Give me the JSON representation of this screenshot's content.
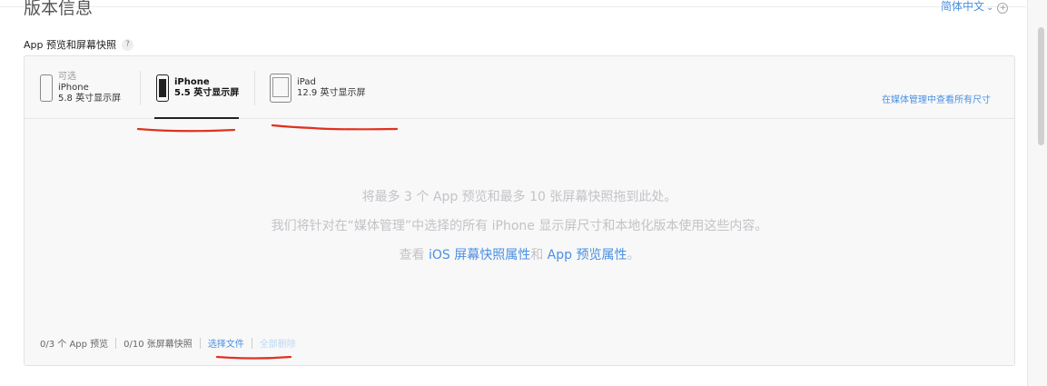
{
  "header": {
    "title": "版本信息",
    "language": "简体中文",
    "language_extra_icon": "plus-circle-icon"
  },
  "section": {
    "title": "App 预览和屏幕快照",
    "help_glyph": "?"
  },
  "tabs": [
    {
      "optional": "可选",
      "name": "iPhone",
      "size": "5.8 英寸显示屏",
      "icon": "iphone-x-icon",
      "active": false
    },
    {
      "optional": "",
      "name": "iPhone",
      "size": "5.5 英寸显示屏",
      "icon": "iphone-icon",
      "active": true
    },
    {
      "optional": "",
      "name": "iPad",
      "size": "12.9 英寸显示屏",
      "icon": "ipad-icon",
      "active": false
    }
  ],
  "view_all_sizes": "在媒体管理中查看所有尺寸",
  "dropzone": {
    "line1": "将最多 3 个 App 预览和最多 10 张屏幕快照拖到此处。",
    "line2": "我们将针对在“媒体管理”中选择的所有 iPhone 显示屏尺寸和本地化版本使用这些内容。",
    "line3_prefix": "查看 ",
    "line3_link1": "iOS 屏幕快照属性",
    "line3_middle": "和 ",
    "line3_link2": "App 预览属性",
    "line3_suffix": "。"
  },
  "footer": {
    "previews_count": "0/3 个 App 预览",
    "screenshots_count": "0/10 张屏幕快照",
    "choose_file": "选择文件",
    "delete_all": "全部删除"
  },
  "colors": {
    "link": "#4a90e2",
    "annotation_red": "#e0321e"
  }
}
